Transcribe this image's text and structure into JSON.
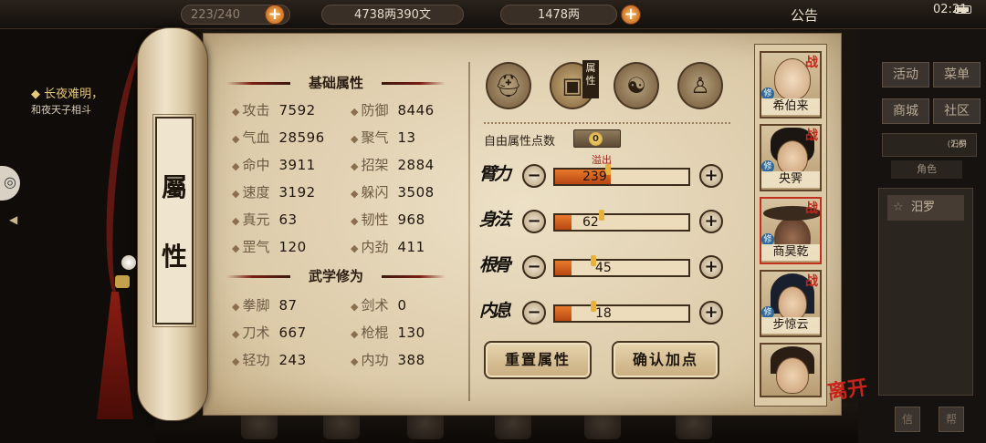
{
  "topbar": {
    "currency_1": "4738两390文",
    "currency_2": "1478两",
    "capacity": "223/240",
    "notice": "公告",
    "clock": "02:21"
  },
  "left": {
    "quest_title": "长夜难明，",
    "quest_sub": "和夜天子相斗"
  },
  "right": {
    "buttons": [
      "活动",
      "菜单",
      "商城",
      "社区"
    ],
    "location": "汨罗",
    "coords": "(7,6)",
    "tab": "角色",
    "map_item": "汨罗",
    "bottom_buttons": [
      "信",
      "帮"
    ]
  },
  "scroll": {
    "rod_title_top": "屬",
    "rod_title_bottom": "性"
  },
  "basic": {
    "header": "基础属性",
    "stats": [
      {
        "label": "攻击",
        "value": "7592"
      },
      {
        "label": "防御",
        "value": "8446"
      },
      {
        "label": "气血",
        "value": "28596"
      },
      {
        "label": "聚气",
        "value": "13"
      },
      {
        "label": "命中",
        "value": "3911"
      },
      {
        "label": "招架",
        "value": "2884"
      },
      {
        "label": "速度",
        "value": "3192"
      },
      {
        "label": "躲闪",
        "value": "3508"
      },
      {
        "label": "真元",
        "value": "63"
      },
      {
        "label": "韧性",
        "value": "968"
      },
      {
        "label": "罡气",
        "value": "120"
      },
      {
        "label": "内劲",
        "value": "411"
      }
    ]
  },
  "martial": {
    "header": "武学修为",
    "stats": [
      {
        "label": "拳脚",
        "value": "87"
      },
      {
        "label": "剑术",
        "value": "0"
      },
      {
        "label": "刀术",
        "value": "667"
      },
      {
        "label": "枪棍",
        "value": "130"
      },
      {
        "label": "轻功",
        "value": "243"
      },
      {
        "label": "内功",
        "value": "388"
      }
    ]
  },
  "tabs": {
    "active_badge": "属性",
    "icons": [
      "hat-icon",
      "box-icon",
      "taiji-icon",
      "body-icon"
    ]
  },
  "alloc": {
    "free_label": "自由属性点数",
    "free_value": "0",
    "overflow_label": "溢出",
    "attrs": [
      {
        "name": "臂力",
        "value": "239",
        "fill": 0.42,
        "pin": 0.38
      },
      {
        "name": "身法",
        "value": "62",
        "fill": 0.12,
        "pin": 0.33
      },
      {
        "name": "根骨",
        "value": "45",
        "fill": 0.12,
        "pin": 0.27
      },
      {
        "name": "内息",
        "value": "18",
        "fill": 0.12,
        "pin": 0.27
      }
    ],
    "reset_label": "重置属性",
    "confirm_label": "确认加点"
  },
  "roster": [
    {
      "name": "希伯来"
    },
    {
      "name": "央霁"
    },
    {
      "name": "商昊乾"
    },
    {
      "name": "步惊云"
    }
  ],
  "badges": {
    "zhan": "战",
    "xiu": "修",
    "leave": "离开"
  },
  "colors": {
    "accent_red": "#c0271a",
    "bar_fill": "#d2601f",
    "paper": "#e4d3b2"
  }
}
